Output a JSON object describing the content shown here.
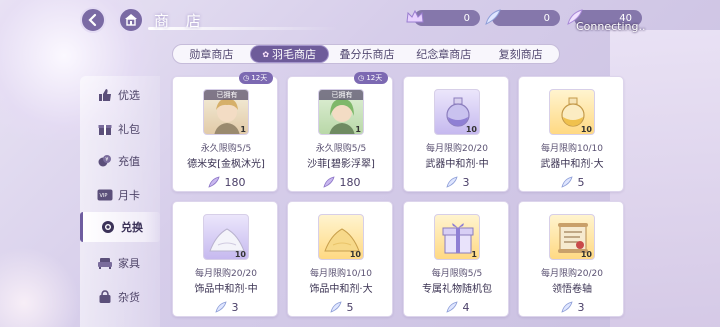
{
  "header": {
    "title": "商 店",
    "connecting": "Connecting..",
    "currencies": [
      {
        "icon": "crown-icon",
        "value": "0"
      },
      {
        "icon": "feather-icon",
        "value": "0"
      },
      {
        "icon": "quill-icon",
        "value": "40"
      }
    ]
  },
  "tabs": [
    {
      "label": "勋章商店",
      "active": false
    },
    {
      "label": "羽毛商店",
      "active": true
    },
    {
      "label": "叠分乐商店",
      "active": false
    },
    {
      "label": "纪念章商店",
      "active": false
    },
    {
      "label": "复刻商店",
      "active": false
    }
  ],
  "sidebar": [
    {
      "label": "优选",
      "icon": "thumbs-up-icon"
    },
    {
      "label": "礼包",
      "icon": "gift-icon"
    },
    {
      "label": "充值",
      "icon": "coins-icon"
    },
    {
      "label": "月卡",
      "icon": "vip-card-icon"
    },
    {
      "label": "兑换",
      "icon": "exchange-icon",
      "active": true
    },
    {
      "label": "家具",
      "icon": "sofa-icon"
    },
    {
      "label": "杂货",
      "icon": "bag-icon"
    }
  ],
  "items": [
    {
      "name": "德米安[金枫沐光]",
      "limit": "永久限购5/5",
      "price": "180",
      "qty": "1",
      "owned": "已拥有",
      "days": "12天",
      "thumb": "chara"
    },
    {
      "name": "沙菲[碧影浮翠]",
      "limit": "永久限购5/5",
      "price": "180",
      "qty": "1",
      "owned": "已拥有",
      "days": "12天",
      "thumb": "chara2"
    },
    {
      "name": "武器中和剂·中",
      "limit": "每月限购20/20",
      "price": "3",
      "qty": "10",
      "thumb": "purple"
    },
    {
      "name": "武器中和剂·大",
      "limit": "每月限购10/10",
      "price": "5",
      "qty": "10",
      "thumb": "gold"
    },
    {
      "name": "饰品中和剂·中",
      "limit": "每月限购20/20",
      "price": "3",
      "qty": "10",
      "thumb": "purple"
    },
    {
      "name": "饰品中和剂·大",
      "limit": "每月限购10/10",
      "price": "5",
      "qty": "10",
      "thumb": "gold"
    },
    {
      "name": "专属礼物随机包",
      "limit": "每月限购5/5",
      "price": "4",
      "qty": "1",
      "thumb": "gold"
    },
    {
      "name": "领悟卷轴",
      "limit": "每月限购20/20",
      "price": "3",
      "qty": "10",
      "thumb": "gold"
    }
  ]
}
